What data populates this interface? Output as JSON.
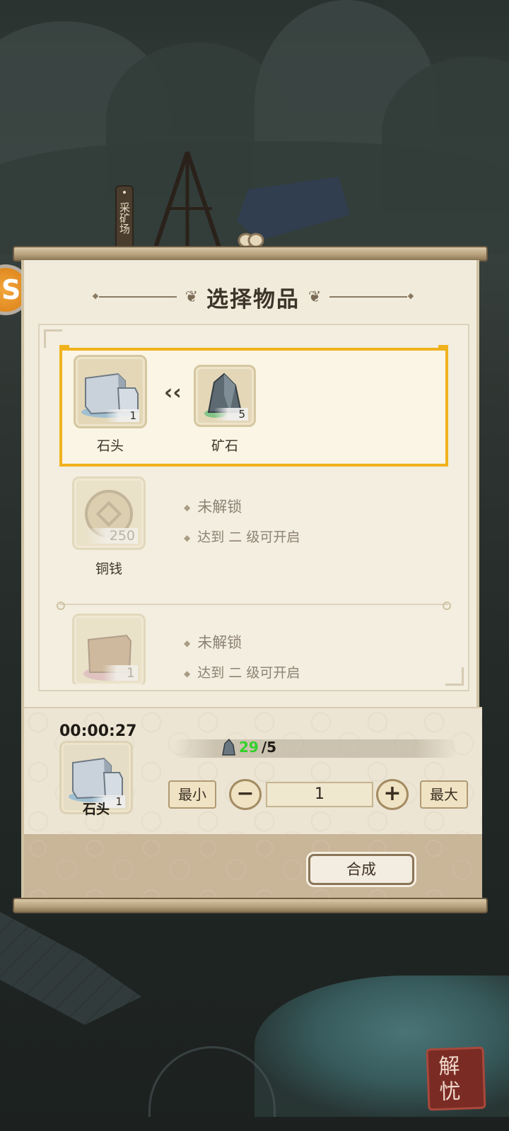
{
  "map": {
    "location_sign": "采矿场",
    "seal_text": "解忧"
  },
  "dialog": {
    "title": "选择物品",
    "recipes": [
      {
        "output": {
          "name": "石头",
          "count": "1",
          "icon": "stone-icon"
        },
        "inputs": [
          {
            "name": "矿石",
            "count": "5",
            "icon": "ore-icon"
          }
        ],
        "selected": true
      },
      {
        "output": {
          "name": "铜钱",
          "count": "250",
          "icon": "copper-coin-icon"
        },
        "locked": true,
        "lock_status": "未解锁",
        "unlock_hint": "达到 二 级可开启"
      },
      {
        "output": {
          "name": "",
          "count": "1",
          "icon": "block-icon"
        },
        "locked": true,
        "lock_status": "未解锁",
        "unlock_hint": "达到 二 级可开启"
      }
    ],
    "craft": {
      "timer": "00:00:27",
      "item_name": "石头",
      "item_count": "1",
      "req_have": "29",
      "req_need": "/5",
      "min_label": "最小",
      "max_label": "最大",
      "minus_label": "−",
      "plus_label": "+",
      "quantity": "1",
      "craft_button": "合成"
    }
  },
  "colors": {
    "selection": "#f0b21c",
    "req_ok": "#33d12a",
    "paper": "#f1ebdc"
  }
}
